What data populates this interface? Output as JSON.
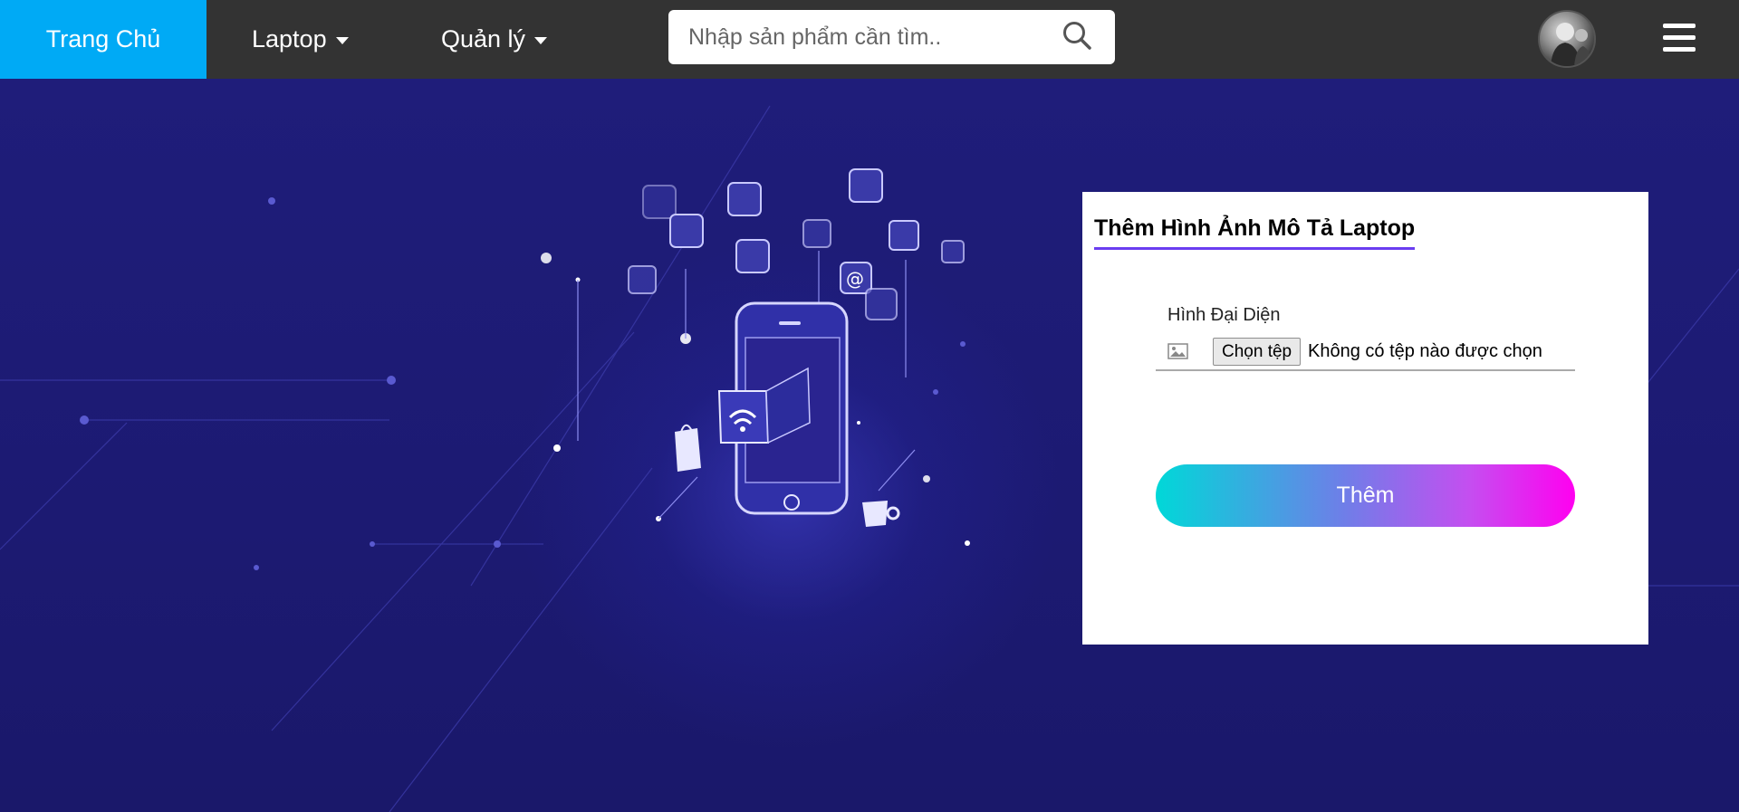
{
  "navbar": {
    "home_label": "Trang Chủ",
    "laptop_label": "Laptop",
    "manage_label": "Quản lý",
    "search_placeholder": "Nhập sản phẩm cần tìm..",
    "search_icon": "search-icon",
    "menu_icon": "hamburger-menu-icon",
    "bg_color": "#333333",
    "active_color": "#00aaf5"
  },
  "form": {
    "title": "Thêm Hình Ảnh Mô Tả Laptop",
    "field_label": "Hình Đại Diện",
    "file_button_label": "Chọn tệp",
    "file_status": "Không có tệp nào được chọn",
    "submit_label": "Thêm",
    "accent_color": "#6a3df0"
  },
  "hero": {
    "bg_color": "#1c1a72",
    "illustration": "smartphone-with-app-icons"
  }
}
